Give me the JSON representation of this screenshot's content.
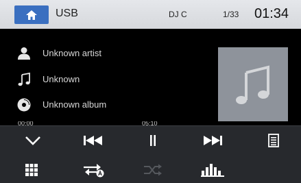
{
  "header": {
    "source_title": "USB",
    "dj_label": "DJ C",
    "track_counter": "1/33",
    "clock": "01:34",
    "home_icon": "home-icon"
  },
  "now_playing": {
    "artist": "Unknown artist",
    "title": "Unknown",
    "album": "Unknown album",
    "artist_icon": "person-icon",
    "title_icon": "music-note-icon",
    "album_icon": "disc-icon",
    "album_art_icon": "music-note-icon"
  },
  "progress": {
    "elapsed": "00:00",
    "total": "05:10"
  },
  "controls": {
    "row1": [
      "chevron-down-icon",
      "previous-track-icon",
      "pause-icon",
      "next-track-icon",
      "playlist-icon"
    ],
    "row2": [
      "grid-menu-icon",
      "repeat-all-icon",
      "shuffle-icon",
      "equalizer-icon"
    ],
    "shuffle_enabled": false
  },
  "colors": {
    "header_bg": "#dfe1e5",
    "home_button": "#3a6fc0",
    "screen_bg": "#000000",
    "control_bar_bg": "#27292d",
    "album_art_bg": "#8e939b",
    "icon_active": "#ffffff",
    "icon_disabled": "#55585d"
  }
}
